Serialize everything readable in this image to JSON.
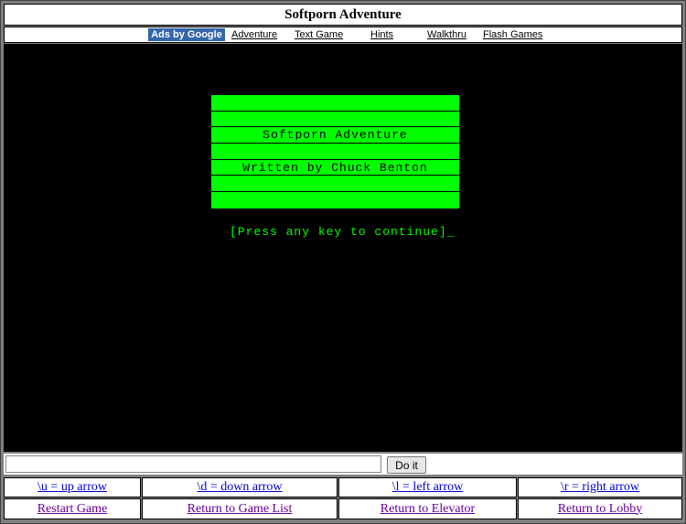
{
  "header": {
    "title": "Softporn Adventure"
  },
  "links": {
    "ads": "Ads by Google",
    "items": [
      "Adventure",
      "Text Game",
      "Hints",
      "Walkthru",
      "Flash Games"
    ]
  },
  "game": {
    "title_line": "Softporn Adventure",
    "author_line": "Written by Chuck Benton",
    "prompt": "[Press any key to continue]_"
  },
  "command": {
    "value": "",
    "button_label": "Do it"
  },
  "arrows": [
    "\\u = up arrow",
    "\\d = down arrow",
    "\\l = left arrow",
    "\\r = right arrow"
  ],
  "nav": [
    "Restart Game",
    "Return to Game List",
    "Return to Elevator",
    "Return to Lobby"
  ],
  "colors": {
    "screen": "#000000",
    "banner": "#00ff00",
    "prompt_text": "#00ff00",
    "ads_badge": "#3366aa"
  }
}
